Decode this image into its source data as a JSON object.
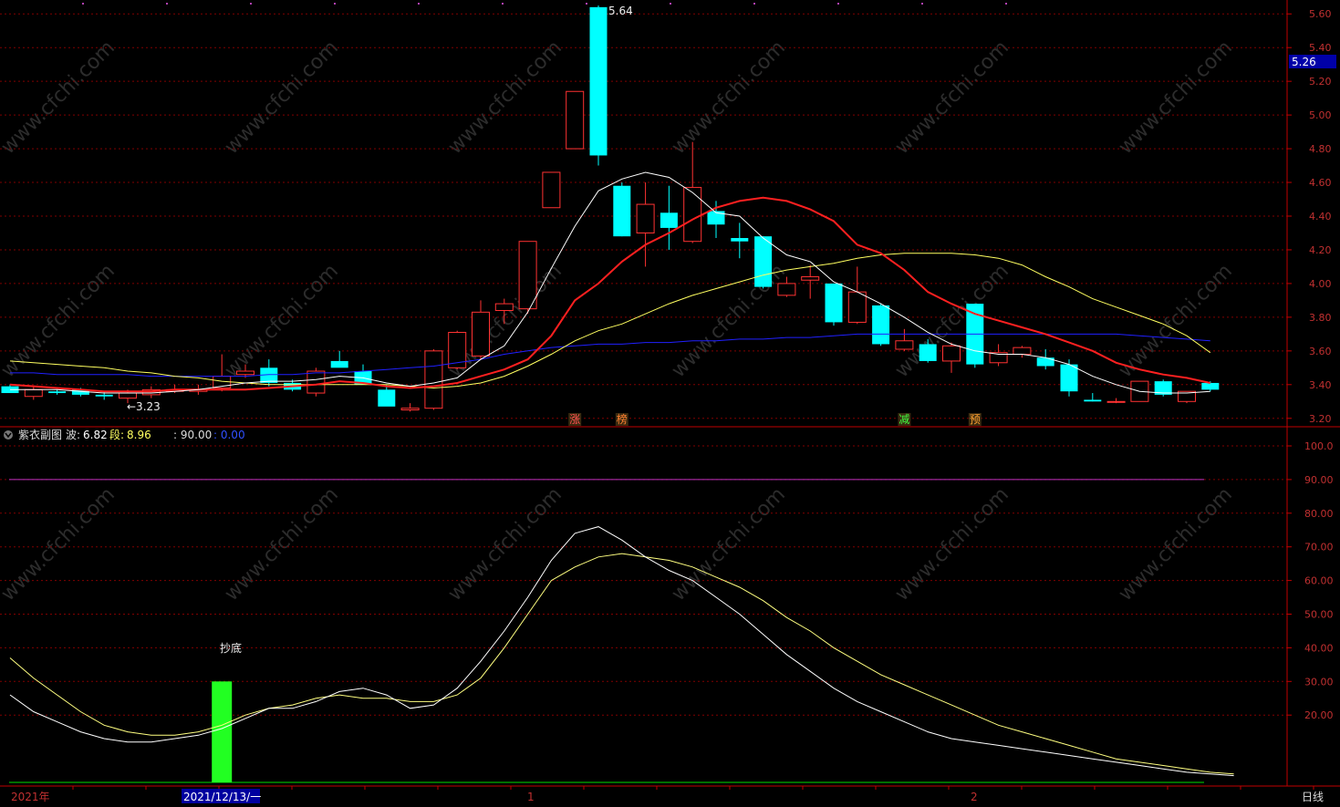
{
  "colors": {
    "background": "#000000",
    "up": "#ff3232",
    "down": "#00ffff",
    "grid": "#800000",
    "axis": "#c00000",
    "ma5": "#ffffff",
    "ma10": "#ff2020",
    "ma20": "#ffff60",
    "ma60": "#2020ff",
    "osc_fast": "#ffffff",
    "osc_slow": "#ffff80",
    "line90": "#c030c0",
    "baseline": "#00dd00",
    "signal_bar": "#22ff22"
  },
  "watermark": "www.cfchi.com",
  "main_panel": {
    "price_ticks": [
      "5.60",
      "5.40",
      "5.20",
      "5.00",
      "4.80",
      "4.60",
      "4.40",
      "4.20",
      "4.00",
      "3.80",
      "3.60",
      "3.40",
      "3.20"
    ],
    "current_price_tag": "5.26",
    "high_label": "5.64",
    "low_label": "←3.23",
    "markers": [
      {
        "text": "涨",
        "color": "#ff5050",
        "bar": 24
      },
      {
        "text": "榜",
        "color": "#ff8030",
        "bar": 26
      },
      {
        "text": "减",
        "color": "#40ff40",
        "bar": 38
      },
      {
        "text": "预",
        "color": "#ffa030",
        "bar": 41
      }
    ]
  },
  "sub_panel": {
    "title": "紫衣副图",
    "wave_label": "波:",
    "wave_value": "6.82",
    "seg_label": "段:",
    "seg_value": "8.96",
    "line_label": ": 90.00",
    "zero_label": ": 0.00",
    "ticks": [
      "100.0",
      "90.00",
      "80.00",
      "70.00",
      "60.00",
      "50.00",
      "40.00",
      "30.00",
      "20.00"
    ],
    "annotation": "抄底"
  },
  "x_axis": {
    "year_label": "2021年",
    "cursor_date": "2021/12/13/一",
    "month_1": "1",
    "month_2": "2",
    "period": "日线"
  },
  "chart_data": [
    {
      "type": "candlestick",
      "ylim": [
        3.15,
        5.65
      ],
      "ohlc": [
        [
          3.39,
          3.4,
          3.35,
          3.35
        ],
        [
          3.33,
          3.39,
          3.31,
          3.37
        ],
        [
          3.36,
          3.37,
          3.34,
          3.35
        ],
        [
          3.37,
          3.38,
          3.33,
          3.34
        ],
        [
          3.34,
          3.36,
          3.31,
          3.33
        ],
        [
          3.32,
          3.37,
          3.29,
          3.35
        ],
        [
          3.34,
          3.39,
          3.32,
          3.37
        ],
        [
          3.36,
          3.4,
          3.35,
          3.37
        ],
        [
          3.36,
          3.4,
          3.34,
          3.37
        ],
        [
          3.38,
          3.58,
          3.36,
          3.45
        ],
        [
          3.46,
          3.52,
          3.44,
          3.48
        ],
        [
          3.5,
          3.55,
          3.39,
          3.41
        ],
        [
          3.41,
          3.43,
          3.36,
          3.37
        ],
        [
          3.35,
          3.5,
          3.33,
          3.48
        ],
        [
          3.54,
          3.6,
          3.51,
          3.5
        ],
        [
          3.48,
          3.52,
          3.43,
          3.4
        ],
        [
          3.37,
          3.4,
          3.33,
          3.27
        ],
        [
          3.25,
          3.29,
          3.24,
          3.26
        ],
        [
          3.26,
          3.61,
          3.25,
          3.6
        ],
        [
          3.5,
          3.72,
          3.49,
          3.71
        ],
        [
          3.57,
          3.9,
          3.55,
          3.83
        ],
        [
          3.84,
          3.91,
          3.76,
          3.88
        ],
        [
          3.85,
          4.25,
          3.82,
          4.25
        ],
        [
          4.45,
          4.66,
          4.46,
          4.66
        ],
        [
          4.8,
          5.14,
          4.84,
          5.14
        ],
        [
          5.64,
          5.65,
          4.7,
          4.76
        ],
        [
          4.58,
          4.6,
          4.28,
          4.28
        ],
        [
          4.3,
          4.6,
          4.1,
          4.47
        ],
        [
          4.42,
          4.58,
          4.2,
          4.33
        ],
        [
          4.25,
          4.84,
          4.24,
          4.57
        ],
        [
          4.43,
          4.49,
          4.27,
          4.35
        ],
        [
          4.27,
          4.36,
          4.15,
          4.25
        ],
        [
          4.28,
          4.28,
          3.97,
          3.98
        ],
        [
          3.93,
          4.04,
          3.92,
          4.0
        ],
        [
          4.02,
          4.11,
          3.91,
          4.04
        ],
        [
          4.0,
          4.0,
          3.75,
          3.77
        ],
        [
          3.77,
          4.1,
          3.76,
          3.95
        ],
        [
          3.87,
          3.88,
          3.63,
          3.64
        ],
        [
          3.61,
          3.73,
          3.6,
          3.66
        ],
        [
          3.64,
          3.67,
          3.53,
          3.54
        ],
        [
          3.54,
          3.65,
          3.47,
          3.63
        ],
        [
          3.88,
          3.88,
          3.5,
          3.52
        ],
        [
          3.53,
          3.64,
          3.51,
          3.59
        ],
        [
          3.58,
          3.63,
          3.56,
          3.62
        ],
        [
          3.56,
          3.61,
          3.49,
          3.51
        ],
        [
          3.52,
          3.55,
          3.33,
          3.36
        ],
        [
          3.31,
          3.35,
          3.3,
          3.3
        ],
        [
          3.3,
          3.32,
          3.29,
          3.3
        ],
        [
          3.3,
          3.42,
          3.3,
          3.42
        ],
        [
          3.42,
          3.43,
          3.33,
          3.34
        ],
        [
          3.3,
          3.36,
          3.29,
          3.36
        ],
        [
          3.41,
          3.42,
          3.36,
          3.37
        ]
      ],
      "ma5": [
        3.37,
        3.37,
        3.37,
        3.36,
        3.35,
        3.35,
        3.35,
        3.36,
        3.37,
        3.39,
        3.41,
        3.42,
        3.42,
        3.43,
        3.45,
        3.44,
        3.41,
        3.39,
        3.41,
        3.44,
        3.55,
        3.63,
        3.83,
        4.09,
        4.34,
        4.55,
        4.62,
        4.66,
        4.63,
        4.54,
        4.42,
        4.4,
        4.27,
        4.17,
        4.13,
        4.01,
        3.95,
        3.88,
        3.8,
        3.71,
        3.64,
        3.6,
        3.58,
        3.58,
        3.56,
        3.52,
        3.45,
        3.4,
        3.36,
        3.35,
        3.35,
        3.36
      ],
      "ma10": [
        3.4,
        3.39,
        3.38,
        3.37,
        3.36,
        3.36,
        3.36,
        3.37,
        3.37,
        3.37,
        3.37,
        3.38,
        3.39,
        3.4,
        3.42,
        3.41,
        3.39,
        3.38,
        3.39,
        3.41,
        3.45,
        3.49,
        3.55,
        3.69,
        3.9,
        4.0,
        4.13,
        4.23,
        4.3,
        4.38,
        4.45,
        4.49,
        4.51,
        4.49,
        4.44,
        4.37,
        4.23,
        4.18,
        4.08,
        3.95,
        3.88,
        3.82,
        3.78,
        3.74,
        3.7,
        3.65,
        3.6,
        3.53,
        3.49,
        3.46,
        3.44,
        3.41
      ],
      "ma20": [
        3.54,
        3.53,
        3.52,
        3.51,
        3.5,
        3.48,
        3.47,
        3.45,
        3.44,
        3.42,
        3.41,
        3.4,
        3.4,
        3.4,
        3.4,
        3.4,
        3.4,
        3.39,
        3.38,
        3.39,
        3.41,
        3.45,
        3.51,
        3.58,
        3.66,
        3.72,
        3.76,
        3.82,
        3.88,
        3.93,
        3.97,
        4.01,
        4.05,
        4.08,
        4.1,
        4.12,
        4.15,
        4.17,
        4.18,
        4.18,
        4.18,
        4.17,
        4.15,
        4.11,
        4.04,
        3.98,
        3.91,
        3.86,
        3.81,
        3.76,
        3.69,
        3.59
      ],
      "ma60": [
        3.47,
        3.47,
        3.46,
        3.46,
        3.46,
        3.46,
        3.45,
        3.45,
        3.45,
        3.45,
        3.45,
        3.46,
        3.46,
        3.47,
        3.47,
        3.48,
        3.49,
        3.5,
        3.51,
        3.53,
        3.55,
        3.58,
        3.6,
        3.62,
        3.63,
        3.64,
        3.64,
        3.65,
        3.65,
        3.66,
        3.66,
        3.67,
        3.67,
        3.68,
        3.68,
        3.69,
        3.7,
        3.7,
        3.7,
        3.7,
        3.7,
        3.7,
        3.7,
        3.7,
        3.7,
        3.7,
        3.7,
        3.7,
        3.69,
        3.68,
        3.67,
        3.66
      ]
    },
    {
      "type": "line",
      "ylim": [
        0,
        110
      ],
      "reference_lines": [
        90,
        0
      ],
      "signal_bar": {
        "bar": 9,
        "value": 30
      },
      "series": [
        {
          "name": "波",
          "values": [
            26,
            21,
            18,
            15,
            13,
            12,
            12,
            13,
            14,
            16,
            19,
            22,
            22,
            24,
            27,
            28,
            26,
            22,
            23,
            28,
            36,
            45,
            55,
            66,
            74,
            76,
            72,
            67,
            63,
            60,
            55,
            50,
            44,
            38,
            33,
            28,
            24,
            21,
            18,
            15,
            13,
            12,
            11,
            10,
            9,
            8,
            7,
            6,
            5,
            4,
            3,
            2.5,
            2
          ]
        },
        {
          "name": "段",
          "values": [
            37,
            31,
            26,
            21,
            17,
            15,
            14,
            14,
            15,
            17,
            20,
            22,
            23,
            25,
            26,
            25,
            25,
            24,
            24,
            26,
            31,
            40,
            50,
            60,
            64,
            67,
            68,
            67,
            66,
            64,
            61,
            58,
            54,
            49,
            45,
            40,
            36,
            32,
            29,
            26,
            23,
            20,
            17,
            15,
            13,
            11,
            9,
            7,
            6,
            5,
            4,
            3,
            2.5
          ]
        }
      ]
    }
  ]
}
